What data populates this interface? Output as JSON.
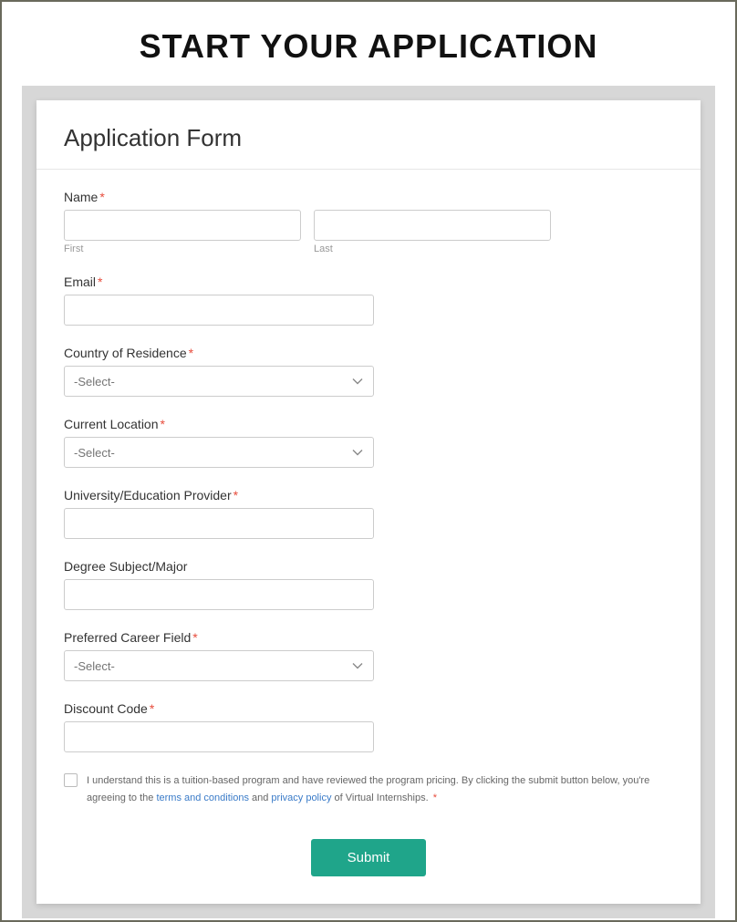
{
  "page_title": "START YOUR APPLICATION",
  "form": {
    "heading": "Application Form",
    "name": {
      "label": "Name",
      "first_sublabel": "First",
      "last_sublabel": "Last",
      "first_value": "",
      "last_value": ""
    },
    "email": {
      "label": "Email",
      "value": ""
    },
    "country": {
      "label": "Country of Residence",
      "placeholder": "-Select-",
      "value": ""
    },
    "location": {
      "label": "Current Location",
      "placeholder": "-Select-",
      "value": ""
    },
    "university": {
      "label": "University/Education Provider",
      "value": ""
    },
    "degree": {
      "label": "Degree Subject/Major",
      "value": ""
    },
    "career": {
      "label": "Preferred Career Field",
      "placeholder": "-Select-",
      "value": ""
    },
    "discount": {
      "label": "Discount Code",
      "value": ""
    },
    "agreement": {
      "text_before": "I understand this is a tuition-based program and have reviewed the program pricing. By clicking the submit button below, you're agreeing to the ",
      "terms_link": "terms and conditions",
      "and": " and ",
      "privacy_link": "privacy policy",
      "text_after": " of Virtual Internships. ",
      "required": "*",
      "checked": false
    },
    "submit_label": "Submit"
  }
}
